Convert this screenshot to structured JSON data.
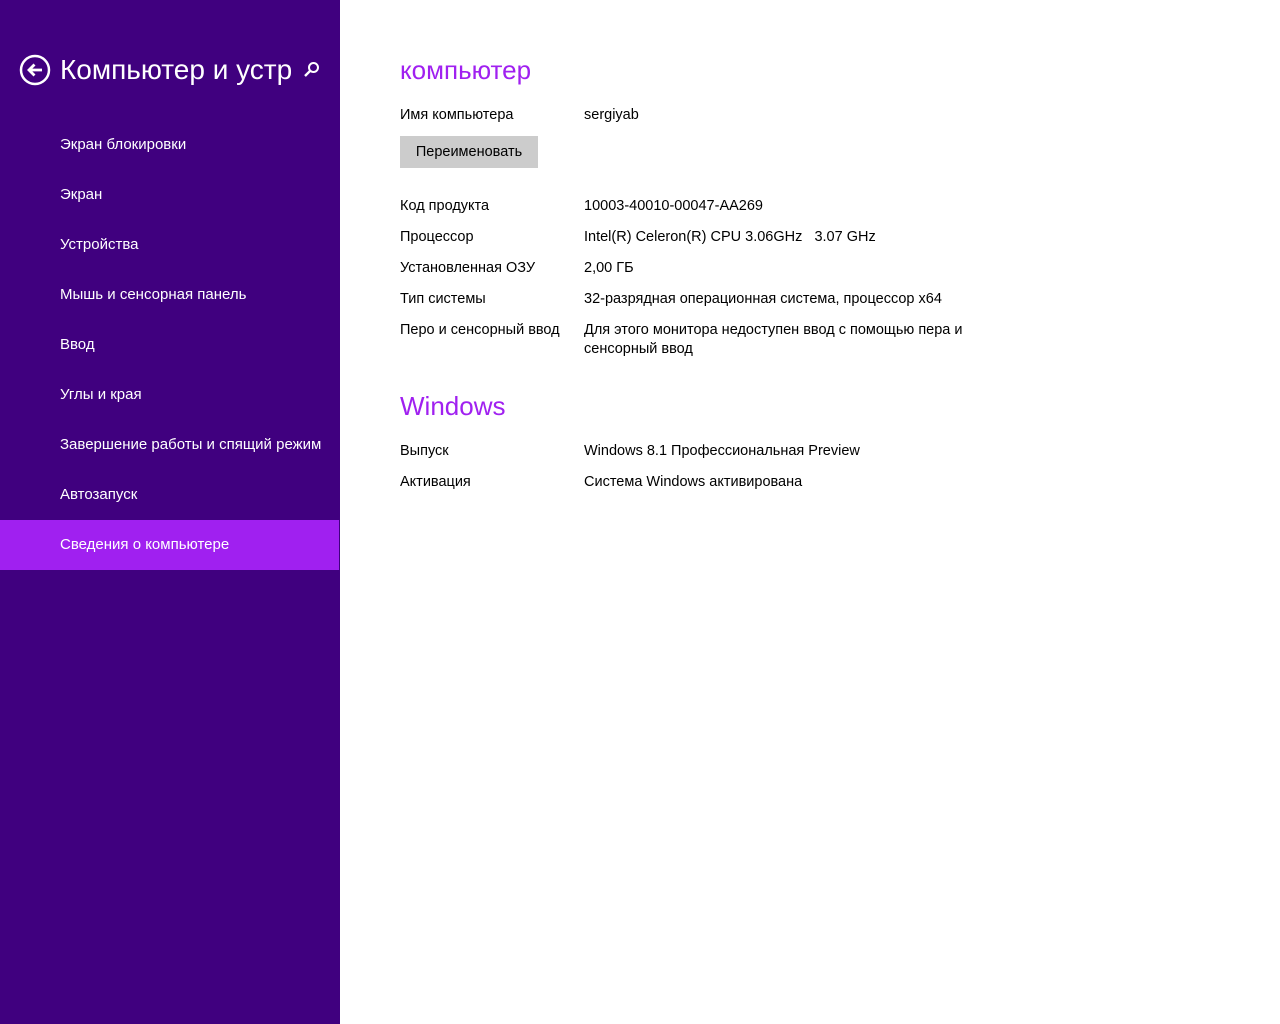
{
  "sidebar": {
    "title": "Компьютер и устр...",
    "back_icon": "back-arrow-circle-icon",
    "search_icon": "search-icon",
    "accent_color": "#40007f",
    "selected_color": "#a020f0",
    "items": [
      {
        "label": "Экран блокировки"
      },
      {
        "label": "Экран"
      },
      {
        "label": "Устройства"
      },
      {
        "label": "Мышь и сенсорная панель"
      },
      {
        "label": "Ввод"
      },
      {
        "label": "Углы и края"
      },
      {
        "label": "Завершение работы и спящий режим"
      },
      {
        "label": "Автозапуск"
      },
      {
        "label": "Сведения о компьютере",
        "selected": true
      }
    ]
  },
  "computer": {
    "heading": "компьютер",
    "name_label": "Имя компьютера",
    "name_value": "sergiyab",
    "rename_label": "Переименовать",
    "product_id_label": "Код продукта",
    "product_id_value": "10003-40010-00047-AA269",
    "processor_label": "Процессор",
    "processor_value": "Intel(R) Celeron(R) CPU 3.06GHz   3.07 GHz",
    "ram_label": "Установленная ОЗУ",
    "ram_value": "2,00 ГБ",
    "system_type_label": "Тип системы",
    "system_type_value": "32-разрядная операционная система, процессор x64",
    "pen_label": "Перо и сенсорный ввод",
    "pen_value": "Для этого монитора недоступен ввод с помощью пера и сенсорный ввод"
  },
  "windows": {
    "heading": "Windows",
    "edition_label": "Выпуск",
    "edition_value": "Windows 8.1 Профессиональная Preview",
    "activation_label": "Активация",
    "activation_value": "Система Windows активирована"
  }
}
